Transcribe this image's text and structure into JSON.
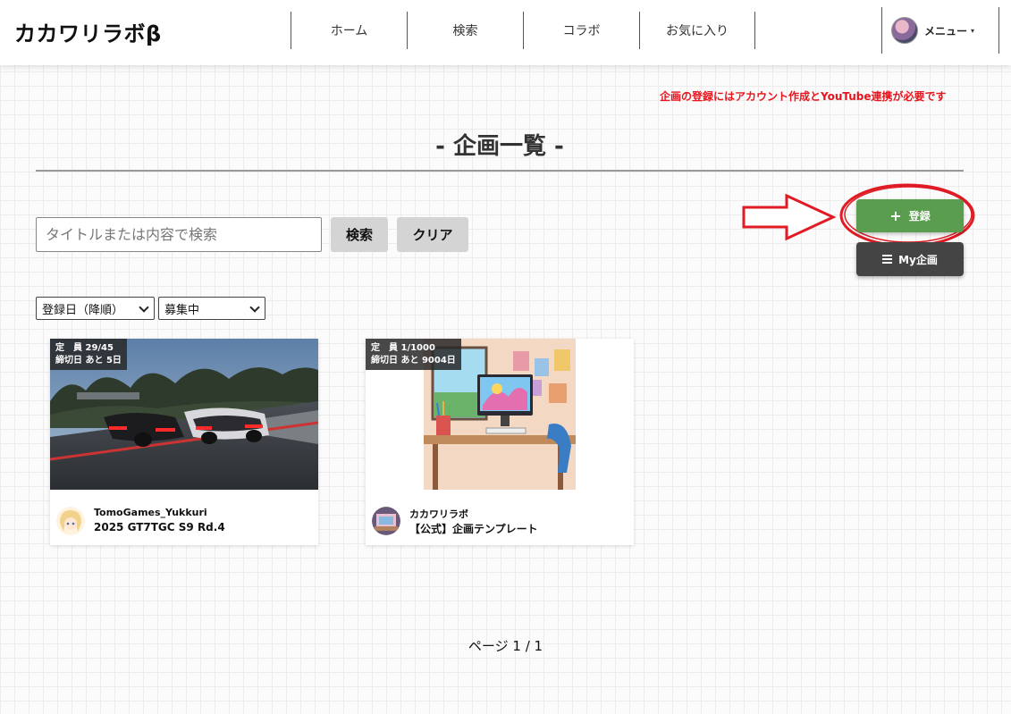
{
  "header": {
    "brand": "カカワリラボβ",
    "nav": [
      "ホーム",
      "検索",
      "コラボ",
      "お気に入り"
    ],
    "menu_label": "メニュー",
    "menu_caret": "▾"
  },
  "notice": "企画の登録にはアカウント作成とYouTube連携が必要です",
  "page_title": "- 企画一覧 -",
  "search": {
    "placeholder": "タイトルまたは内容で検索",
    "search_label": "検索",
    "clear_label": "クリア"
  },
  "actions": {
    "register_label": "登録",
    "register_icon": "plus-icon",
    "my_label": "My企画",
    "my_icon": "list-icon"
  },
  "filters": {
    "sort_selected": "登録日（降順）",
    "status_selected": "募集中"
  },
  "cards": [
    {
      "capacity": "定　員 29/45",
      "deadline": "締切日 あと 5日",
      "author": "TomoGames_Yukkuri",
      "title": "2025 GT7TGC S9 Rd.4"
    },
    {
      "capacity": "定　員 1/1000",
      "deadline": "締切日 あと 9004日",
      "author": "カカワリラボ",
      "title": "【公式】企画テンプレート"
    }
  ],
  "pager": "ページ 1 / 1",
  "colors": {
    "register_green": "#5a9d4f",
    "my_dark": "#444444",
    "notice_red": "#e8141c",
    "annotation_red": "#e01b24"
  }
}
